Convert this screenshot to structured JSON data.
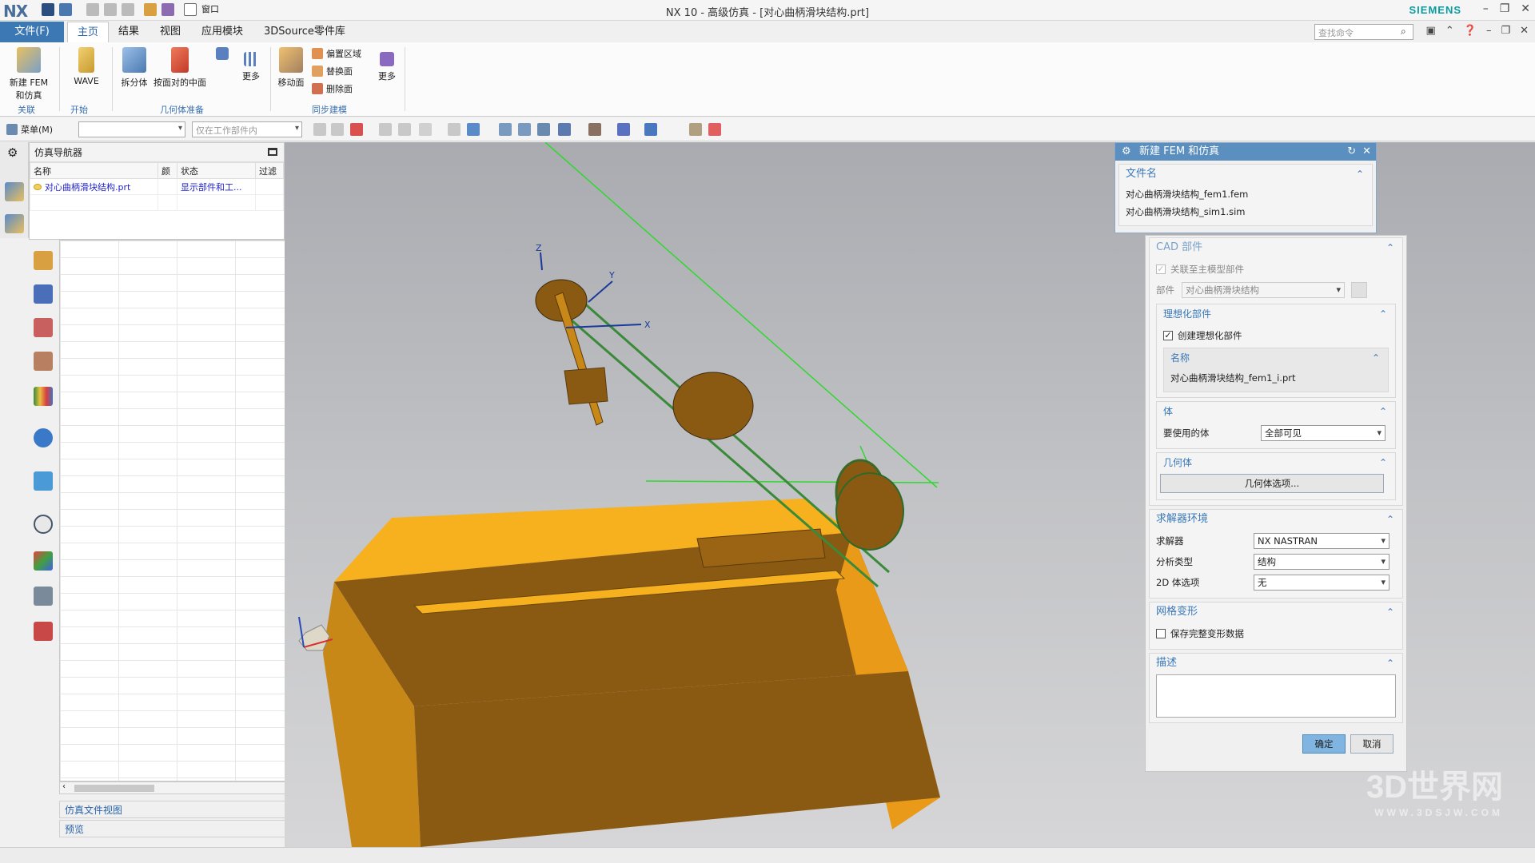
{
  "titlebar": {
    "logo": "NX",
    "window_menu": "窗口",
    "title": "NX 10 - 高级仿真 - [对心曲柄滑块结构.prt]",
    "brand": "SIEMENS"
  },
  "tabs": {
    "file": "文件(F)",
    "items": [
      "主页",
      "结果",
      "视图",
      "应用模块",
      "3DSource零件库"
    ],
    "search_placeholder": "查找命令"
  },
  "ribbon": {
    "new_fem": "新建 FEM 和仿真",
    "wave": "WAVE",
    "split_body": "拆分体",
    "midsurface": "按面对的中面",
    "more1": "更多",
    "move_face": "移动面",
    "offset_region": "偏置区域",
    "replace_face": "替换面",
    "delete_face": "删除面",
    "more2": "更多",
    "groups": {
      "assoc": "关联",
      "start": "开始",
      "geom_prep": "几何体准备",
      "sync": "同步建模"
    }
  },
  "toolbar2": {
    "menu": "菜单(M)",
    "filter_placeholder": "仅在工作部件内"
  },
  "navigator": {
    "title": "仿真导航器",
    "columns": [
      "名称",
      "颜",
      "状态",
      "过滤"
    ],
    "rows": [
      {
        "name": "对心曲柄滑块结构.prt",
        "status": "显示部件和工..."
      }
    ],
    "section_file_view": "仿真文件视图",
    "section_preview": "预览"
  },
  "dialog": {
    "title": "新建 FEM 和仿真",
    "filename": {
      "header": "文件名",
      "fem": "对心曲柄滑块结构_fem1.fem",
      "sim": "对心曲柄滑块结构_sim1.sim"
    },
    "cad": {
      "header": "CAD 部件",
      "assoc_master": "关联至主模型部件",
      "part_label": "部件",
      "part_value": "对心曲柄滑块结构"
    },
    "idealized": {
      "header": "理想化部件",
      "create": "创建理想化部件",
      "name_header": "名称",
      "name_value": "对心曲柄滑块结构_fem1_i.prt"
    },
    "body": {
      "header": "体",
      "label": "要使用的体",
      "value": "全部可见"
    },
    "geometry": {
      "header": "几何体",
      "button": "几何体选项..."
    },
    "solver_env": {
      "header": "求解器环境",
      "solver_label": "求解器",
      "solver_value": "NX NASTRAN",
      "analysis_label": "分析类型",
      "analysis_value": "结构",
      "body2d_label": "2D 体选项",
      "body2d_value": "无"
    },
    "mesh": {
      "header": "网格变形",
      "save": "保存完整变形数据"
    },
    "desc": {
      "header": "描述"
    },
    "ok": "确定",
    "cancel": "取消"
  },
  "viewport": {
    "axes": [
      "Z",
      "Y",
      "X"
    ]
  },
  "watermark": {
    "main": "3D世界网",
    "sub": "WWW.3DSJW.COM"
  },
  "colors": {
    "accent": "#3c78b4",
    "model_body": "#f7a81b",
    "model_dark": "#8a5a12",
    "belt": "#3a8a3a"
  }
}
